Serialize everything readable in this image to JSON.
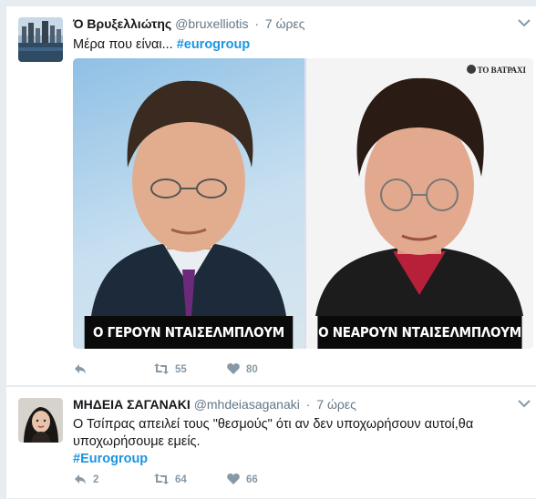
{
  "tweets": [
    {
      "name": "Ό Βρυξελλιώτης",
      "handle": "@bruxelliotis",
      "time": "7 ώρες",
      "text": "Μέρα που είναι... ",
      "hashtag": "#eurogroup",
      "media": {
        "left_caption": "Ο ΓΕΡΟΥΝ ΝΤΑΙΣΕΛΜΠΛΟΥΜ",
        "right_caption": "Ο ΝΕΑΡΟΥΝ ΝΤΑΙΣΕΛΜΠΛΟΥΜ",
        "watermark": "ΤΟ ΒΑΤΡΑΧΙ"
      },
      "actions": {
        "reply": "",
        "retweet": "55",
        "like": "80"
      }
    },
    {
      "name": "ΜΗΔΕΙΑ ΣΑΓΑΝΑΚΙ",
      "handle": "@mhdeiasaganaki",
      "time": "7 ώρες",
      "text": "Ο Τσίπρας απειλεί τους \"θεσμούς\" ότι αν δεν υποχωρήσουν αυτοί,θα υποχωρήσουμε εμείς.",
      "hashtag": "#Eurogroup",
      "actions": {
        "reply": "2",
        "retweet": "64",
        "like": "66"
      }
    }
  ],
  "colors": {
    "link": "#1b95e0",
    "icon": "#8899a6",
    "background": "#e6ecf0"
  },
  "icons": [
    "reply-icon",
    "retweet-icon",
    "heart-icon",
    "caret-down-icon"
  ]
}
